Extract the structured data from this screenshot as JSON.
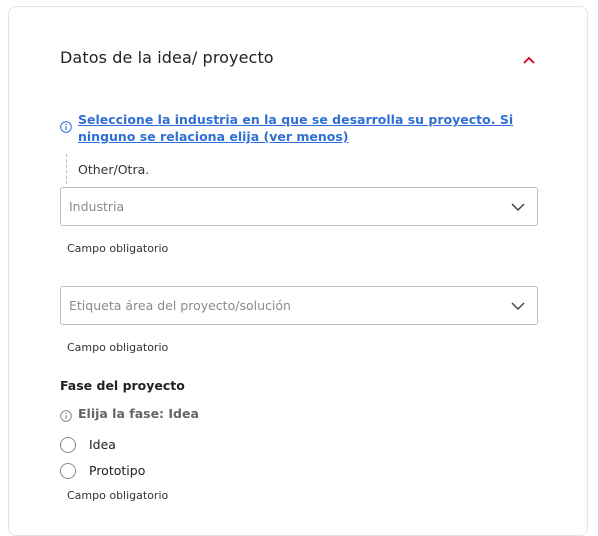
{
  "section": {
    "title": "Datos de la idea/ proyecto"
  },
  "industry": {
    "info_link": "Seleccione la industria en la que se desarrolla su proyecto. Si ninguno se relaciona elija (ver menos)",
    "selected_value": "Other/Otra.",
    "select_placeholder": "Industria",
    "required_text": "Campo obligatorio"
  },
  "area_tag": {
    "select_placeholder": "Etiqueta área del proyecto/solución",
    "required_text": "Campo obligatorio"
  },
  "phase": {
    "heading": "Fase del proyecto",
    "info_text": "Elija la fase: Idea",
    "options": [
      {
        "label": "Idea"
      },
      {
        "label": "Prototipo"
      }
    ],
    "required_text": "Campo obligatorio"
  },
  "colors": {
    "link": "#2f6fd6",
    "accent_red": "#d0021b",
    "border": "#bdbdbd"
  },
  "icons": {
    "collapse": "chevron-up-icon",
    "info": "info-icon",
    "dropdown": "chevron-down-icon",
    "radio": "radio-empty"
  }
}
